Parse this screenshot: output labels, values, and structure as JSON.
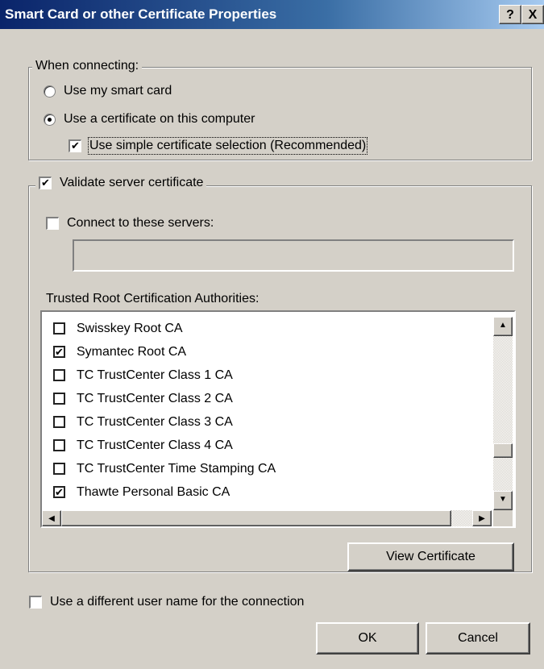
{
  "window": {
    "title": "Smart Card or other Certificate Properties",
    "help_label": "?",
    "close_label": "X"
  },
  "connecting": {
    "legend": "When connecting:",
    "use_smart_card": "Use my smart card",
    "use_certificate": "Use a certificate on this computer",
    "selected_option": "use_certificate",
    "simple_selection": "Use simple certificate selection (Recommended)",
    "simple_selection_checked": true
  },
  "validate": {
    "legend": "Validate server certificate",
    "checked": true,
    "connect_servers_label": "Connect to these servers:",
    "connect_servers_checked": false,
    "servers_value": "",
    "trusted_label": "Trusted Root Certification Authorities:",
    "authorities": [
      {
        "name": "Swisskey Root CA",
        "checked": false
      },
      {
        "name": "Symantec Root CA",
        "checked": true
      },
      {
        "name": "TC TrustCenter Class 1 CA",
        "checked": false
      },
      {
        "name": "TC TrustCenter Class 2 CA",
        "checked": false
      },
      {
        "name": "TC TrustCenter Class 3 CA",
        "checked": false
      },
      {
        "name": "TC TrustCenter Class 4 CA",
        "checked": false
      },
      {
        "name": "TC TrustCenter Time Stamping CA",
        "checked": false
      },
      {
        "name": "Thawte Personal Basic CA",
        "checked": true
      }
    ],
    "view_certificate": "View Certificate"
  },
  "different_user": {
    "label": "Use a different user name for the connection",
    "checked": false
  },
  "buttons": {
    "ok": "OK",
    "cancel": "Cancel"
  }
}
